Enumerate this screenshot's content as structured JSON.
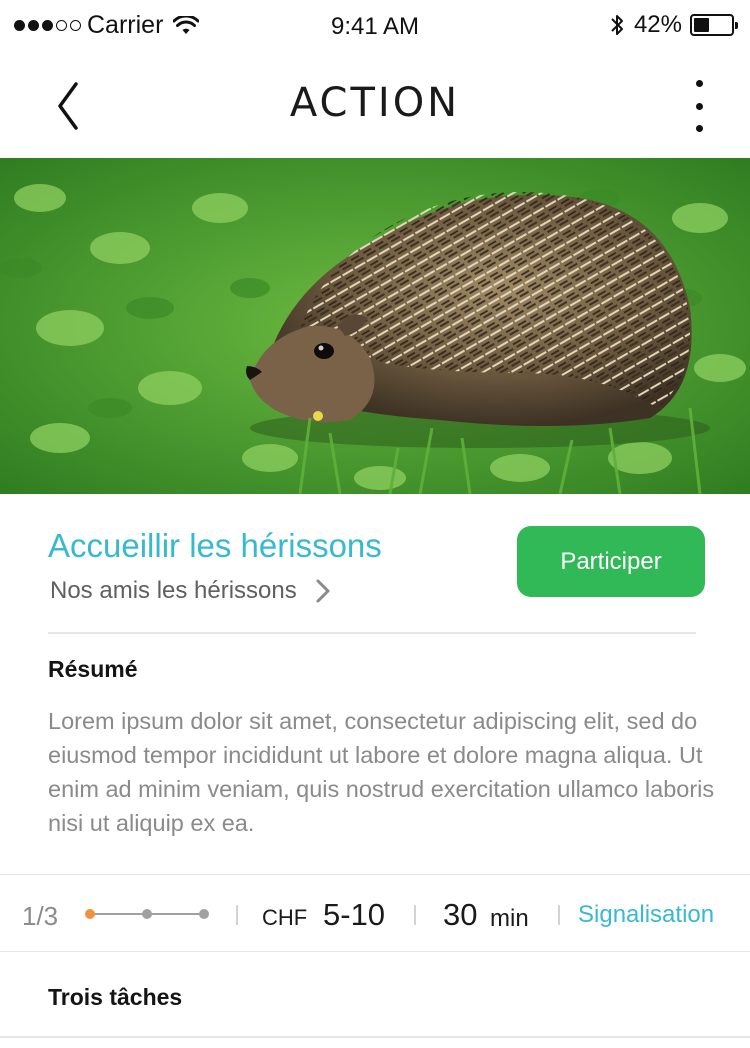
{
  "status_bar": {
    "carrier": "Carrier",
    "time": "9:41 AM",
    "battery_text": "42%",
    "battery_level": 0.42
  },
  "nav": {
    "title": "ACTION",
    "back_icon": "chevron-left-icon",
    "more_icon": "more-vertical-icon"
  },
  "hero": {
    "icon": "hedgehog-photo"
  },
  "action": {
    "title": "Accueillir les hérissons",
    "category": "Nos amis les hérissons",
    "participate_label": "Participer"
  },
  "summary": {
    "heading": "Résumé",
    "text": "Lorem ipsum dolor sit amet, consectetur adipiscing elit, sed do eiusmod tempor incididunt ut labore et dolore magna aliqua. Ut enim ad minim veniam, quis nostrud exercitation ullamco laboris nisi ut aliquip ex ea."
  },
  "info_bar": {
    "step": "1/3",
    "progress_steps": 3,
    "progress_current": 1,
    "currency": "CHF",
    "cost": "5-10",
    "duration_value": "30",
    "duration_unit": "min",
    "report_label": "Signalisation"
  },
  "tasks": {
    "heading": "Trois tâches"
  },
  "colors": {
    "accent": "#38b9d2",
    "button": "#31b857",
    "progress_active": "#f2913d",
    "progress_inactive": "#a0a0a0"
  }
}
